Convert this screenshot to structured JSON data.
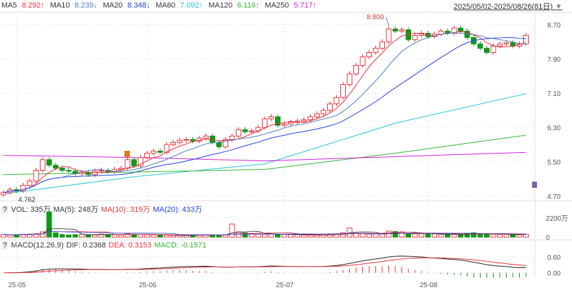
{
  "legend": {
    "items": [
      {
        "label": "MA5",
        "value": "8.292↑",
        "color": "#e8313c"
      },
      {
        "label": "MA10",
        "value": "8.239↓",
        "color": "#4a7fc0"
      },
      {
        "label": "MA20",
        "value": "8.348↓",
        "color": "#1f3fe0"
      },
      {
        "label": "MA60",
        "value": "7.092↑",
        "color": "#22c4d8"
      },
      {
        "label": "MA120",
        "value": "6.116↑",
        "color": "#2fb52f"
      },
      {
        "label": "MA250",
        "value": "5.717↑",
        "color": "#d01fd8"
      }
    ]
  },
  "range": "2025/05/02-2025/08/26(81日)",
  "vol_legend": {
    "q": "?",
    "items": [
      {
        "text": "VOL: 335万",
        "color": "#333"
      },
      {
        "text": "MA(5): 248万",
        "color": "#333"
      },
      {
        "text": "MA(10): 319万",
        "color": "#e8313c"
      },
      {
        "text": "MA(20): 433万",
        "color": "#1f3fe0"
      }
    ]
  },
  "macd_legend": {
    "q": "?",
    "items": [
      {
        "text": "MACD(12,26,9)",
        "color": "#333"
      },
      {
        "text": "DIF: 0.2368",
        "color": "#333"
      },
      {
        "text": "DEA: 0.3153",
        "color": "#e8313c"
      },
      {
        "text": "MACD: -0.1571",
        "color": "#2fb52f"
      }
    ]
  },
  "chart_data": {
    "type": "candlestick",
    "price_ticks": [
      8.7,
      7.9,
      7.1,
      6.3,
      5.5,
      4.7
    ],
    "ylim": [
      4.55,
      8.95
    ],
    "vol_ticks": [
      "2200万",
      "0"
    ],
    "macd_ticks": [
      "0.60",
      "0.00"
    ],
    "x_ticks": [
      {
        "label": "25-05",
        "index": 2
      },
      {
        "label": "25-06",
        "index": 22
      },
      {
        "label": "25-07",
        "index": 43
      },
      {
        "label": "25-08",
        "index": 65
      }
    ],
    "annotations": {
      "high": "8.800",
      "low": "4.762"
    },
    "colors": {
      "up": "#e8313c",
      "down": "#14961e"
    },
    "close": [
      4.78,
      4.85,
      4.82,
      4.95,
      5.05,
      5.3,
      5.55,
      5.42,
      5.35,
      5.3,
      5.28,
      5.22,
      5.25,
      5.2,
      5.28,
      5.3,
      5.27,
      5.32,
      5.35,
      5.55,
      5.4,
      5.6,
      5.7,
      5.75,
      5.72,
      5.9,
      5.95,
      6.0,
      6.02,
      5.98,
      6.05,
      6.1,
      5.95,
      5.85,
      6.02,
      6.1,
      6.25,
      6.2,
      6.22,
      6.3,
      6.5,
      6.55,
      6.35,
      6.38,
      6.42,
      6.45,
      6.48,
      6.55,
      6.62,
      6.7,
      6.85,
      7.0,
      7.3,
      7.55,
      7.75,
      7.95,
      8.05,
      8.15,
      8.3,
      8.6,
      8.55,
      8.58,
      8.35,
      8.45,
      8.5,
      8.42,
      8.48,
      8.55,
      8.5,
      8.62,
      8.55,
      8.4,
      8.25,
      8.15,
      8.05,
      8.2,
      8.25,
      8.28,
      8.2,
      8.25,
      8.45
    ],
    "volume": [
      300,
      250,
      280,
      320,
      350,
      400,
      600,
      3000,
      500,
      300,
      250,
      300,
      320,
      280,
      250,
      350,
      300,
      280,
      250,
      400,
      320,
      300,
      280,
      260,
      250,
      230,
      220,
      200,
      210,
      220,
      240,
      260,
      250,
      230,
      260,
      1500,
      600,
      500,
      420,
      380,
      330,
      360,
      340,
      320,
      300,
      280,
      250,
      230,
      220,
      250,
      300,
      400,
      500,
      1050,
      550,
      420,
      350,
      380,
      360,
      700,
      650,
      600,
      420,
      380,
      400,
      420,
      380,
      320,
      330,
      300,
      280,
      420,
      500,
      380,
      350,
      330,
      300,
      320,
      300,
      280,
      335
    ],
    "ma60": [
      [
        0,
        4.75
      ],
      [
        20,
        5.15
      ],
      [
        40,
        5.45
      ],
      [
        60,
        6.4
      ],
      [
        80,
        7.09
      ]
    ],
    "ma120": [
      [
        0,
        5.2
      ],
      [
        40,
        5.32
      ],
      [
        60,
        5.7
      ],
      [
        80,
        6.12
      ]
    ],
    "ma250": [
      [
        0,
        5.65
      ],
      [
        20,
        5.6
      ],
      [
        40,
        5.52
      ],
      [
        60,
        5.62
      ],
      [
        80,
        5.72
      ]
    ]
  }
}
